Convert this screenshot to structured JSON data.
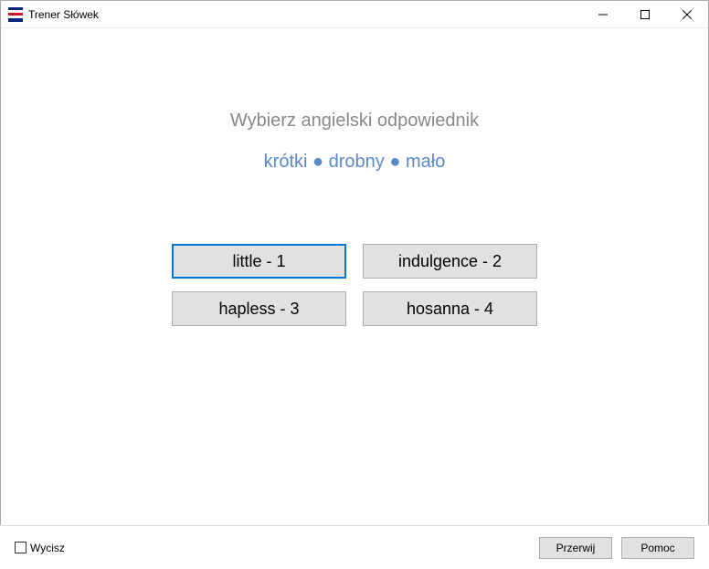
{
  "window": {
    "title": "Trener Słówek"
  },
  "quiz": {
    "prompt": "Wybierz angielski odpowiednik",
    "words": "krótki ● drobny ● mało",
    "options": [
      {
        "label": "little - 1",
        "selected": true
      },
      {
        "label": "indulgence - 2",
        "selected": false
      },
      {
        "label": "hapless - 3",
        "selected": false
      },
      {
        "label": "hosanna - 4",
        "selected": false
      }
    ]
  },
  "footer": {
    "mute_label": "Wycisz",
    "mute_checked": false,
    "abort_label": "Przerwij",
    "help_label": "Pomoc"
  }
}
